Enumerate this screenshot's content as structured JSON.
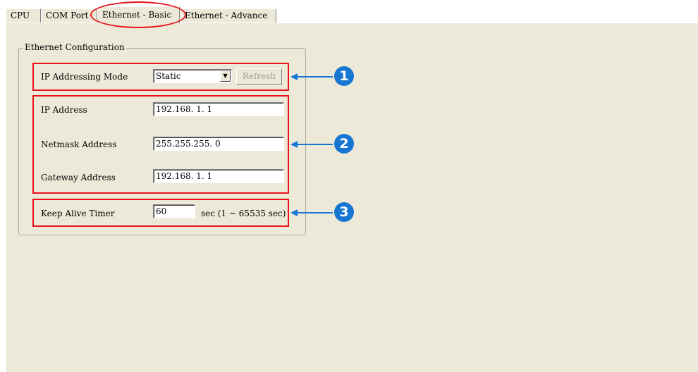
{
  "tabs": [
    {
      "label": "CPU"
    },
    {
      "label": "COM Port"
    },
    {
      "label": "Ethernet - Basic"
    },
    {
      "label": "Ethernet - Advance"
    }
  ],
  "group": {
    "title": "Ethernet Configuration",
    "ip_mode": {
      "label": "IP Addressing Mode",
      "value": "Static",
      "refresh_label": "Refresh"
    },
    "ip_address": {
      "label": "IP Address",
      "value": "192.168.  1.  1"
    },
    "netmask": {
      "label": "Netmask Address",
      "value": "255.255.255.  0"
    },
    "gateway": {
      "label": "Gateway Address",
      "value": "192.168.  1.  1"
    },
    "keep_alive": {
      "label": "Keep Alive Timer",
      "value": "60",
      "unit": "sec (1 ~ 65535 sec)"
    }
  },
  "callouts": [
    "1",
    "2",
    "3"
  ],
  "colors": {
    "annotation_red": "#e8131a",
    "callout_blue": "#1676d2",
    "panel_bg": "#ece9d8"
  },
  "icons": {
    "dropdown": "chevron-down-icon",
    "callout_arrow": "arrow-left-icon"
  }
}
